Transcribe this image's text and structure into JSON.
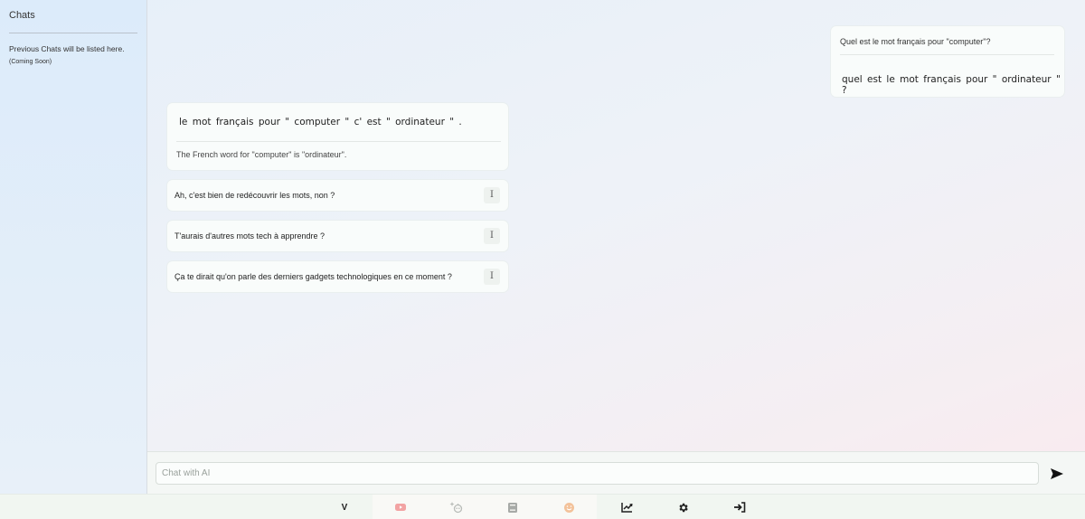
{
  "sidebar": {
    "title": "Chats",
    "note": "Previous Chats will be listed here.",
    "coming_soon": "(Coming Soon)"
  },
  "conversation": {
    "user_message": {
      "original": "Quel est le mot français pour \"computer\"?",
      "translation": "quel est le mot français pour \" ordinateur \" ?"
    },
    "ai_message": {
      "original": "le mot français pour \" computer \" c' est \" ordinateur \" .",
      "translation": "The French word for \"computer\" is \"ordinateur\"."
    },
    "suggestions": [
      {
        "text": "Ah, c'est bien de redécouvrir les mots, non ?",
        "icon": "info-icon",
        "icon_glyph": "I"
      },
      {
        "text": "T'aurais d'autres mots tech à apprendre ?",
        "icon": "info-icon",
        "icon_glyph": "I"
      },
      {
        "text": "Ça te dirait qu'on parle des derniers gadgets technologiques en ce moment ?",
        "icon": "info-icon",
        "icon_glyph": "I"
      }
    ]
  },
  "input": {
    "placeholder": "Chat with AI",
    "value": "",
    "send_icon": "send-icon"
  },
  "bottom_nav": {
    "items": [
      {
        "label": "V",
        "icon": "v-text"
      },
      {
        "icon": "video-icon",
        "color": "#f2a3a3"
      },
      {
        "icon": "sparkle-bot-icon",
        "color": "#b9bdb9"
      },
      {
        "icon": "book-icon",
        "color": "#a7aaa7"
      },
      {
        "icon": "face-icon",
        "color": "#f3c29a"
      },
      {
        "icon": "chart-icon",
        "color": "#1f1f1f"
      },
      {
        "icon": "gear-icon",
        "color": "#1f1f1f"
      },
      {
        "icon": "login-icon",
        "color": "#1f1f1f"
      }
    ]
  }
}
